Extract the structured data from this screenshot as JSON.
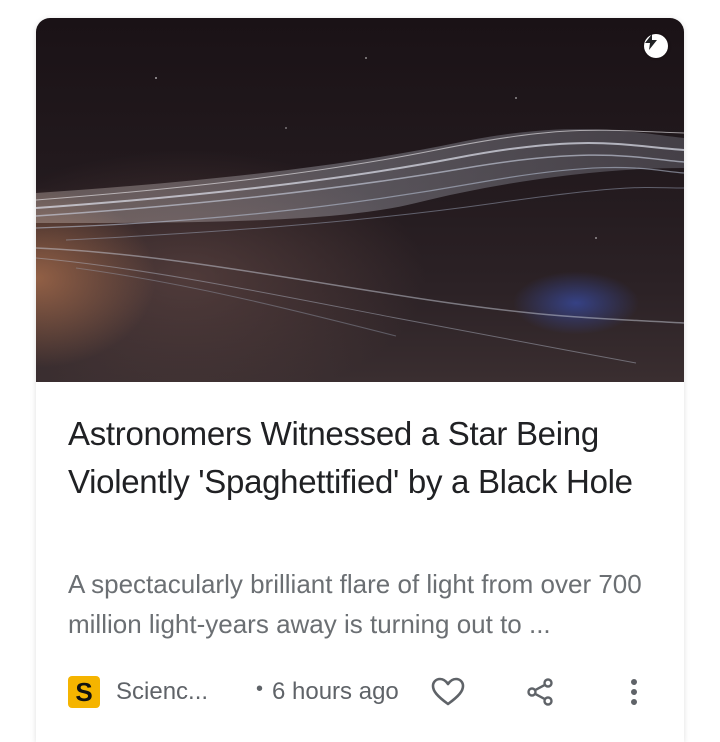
{
  "article": {
    "title": "Astronomers Witnessed a Star Being Violently 'Spaghettified' by a Black Hole",
    "snippet": "A spectacularly brilliant flare of light from over 700 million light-years away is turning out to ...",
    "image_alt": "Artist impression of a star being spaghettified by a black hole",
    "amp_icon": "lightning-bolt-icon"
  },
  "footer": {
    "source_logo_letter": "S",
    "source_name": "Scienc...",
    "separator": "•",
    "time": "6 hours ago",
    "like_icon": "heart-outline-icon",
    "share_icon": "share-icon",
    "more_icon": "more-vert-icon"
  },
  "colors": {
    "title": "#202124",
    "snippet": "#6b6f73",
    "source_logo_bg": "#f5b400",
    "icon": "#5f6368"
  }
}
